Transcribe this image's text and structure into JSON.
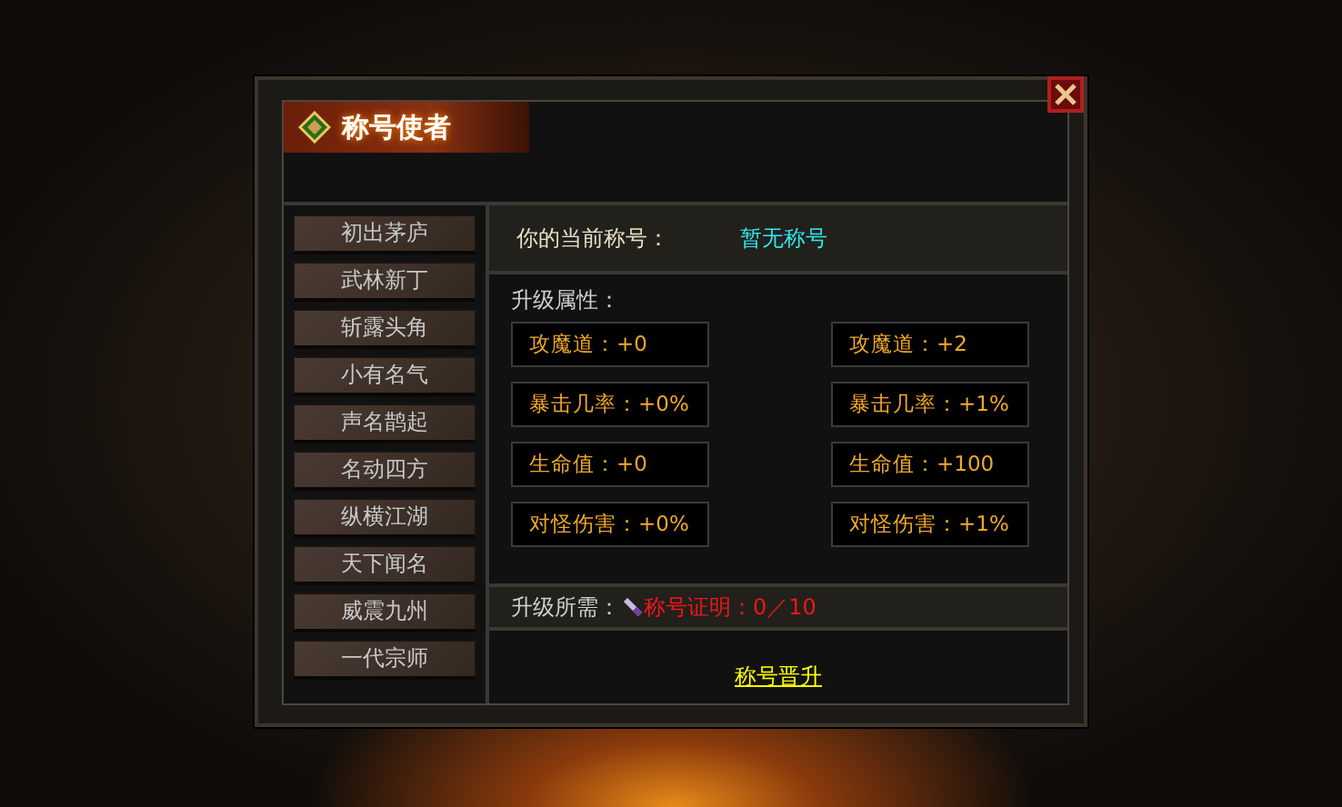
{
  "window": {
    "title": "称号使者"
  },
  "titles": [
    {
      "label": "初出茅庐"
    },
    {
      "label": "武林新丁"
    },
    {
      "label": "斩露头角"
    },
    {
      "label": "小有名气"
    },
    {
      "label": "声名鹊起"
    },
    {
      "label": "名动四方"
    },
    {
      "label": "纵横江湖"
    },
    {
      "label": "天下闻名"
    },
    {
      "label": "威震九州"
    },
    {
      "label": "一代宗师"
    }
  ],
  "current": {
    "label": "你的当前称号：",
    "value": "暂无称号"
  },
  "attributes": {
    "heading": "升级属性：",
    "rows": [
      {
        "current": "攻魔道：+0",
        "next": "攻魔道：+2"
      },
      {
        "current": "暴击几率：+0%",
        "next": "暴击几率：+1%"
      },
      {
        "current": "生命值：+0",
        "next": "生命值：+100"
      },
      {
        "current": "对怪伤害：+0%",
        "next": "对怪伤害：+1%"
      }
    ]
  },
  "requirement": {
    "label": "升级所需：",
    "item": "称号证明：0／10"
  },
  "upgrade_link": "称号晋升"
}
